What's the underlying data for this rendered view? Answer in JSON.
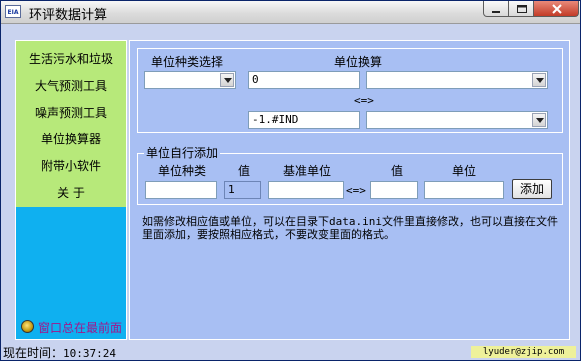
{
  "window": {
    "title": "环评数据计算",
    "icon_text": "EIA",
    "icon": "eia-app-icon"
  },
  "nav": {
    "items": [
      {
        "label": "生活污水和垃圾"
      },
      {
        "label": "大气预测工具"
      },
      {
        "label": "噪声预测工具"
      },
      {
        "label": "单位换算器"
      },
      {
        "label": "附带小软件"
      },
      {
        "label": "关  于"
      }
    ],
    "pin_label": "窗口总在最前面",
    "pin_icon": "pin-circle-icon"
  },
  "converter": {
    "unit_type_label": "单位种类选择",
    "conversion_label": "单位换算",
    "unit_type_value": "",
    "input_value": "0",
    "from_unit": "",
    "swap_label": "<=>",
    "result_value": "-1.#IND",
    "to_unit": ""
  },
  "custom_units": {
    "group_title": "单位自行添加",
    "col_type": "单位种类",
    "col_value": "值",
    "col_base_unit": "基准单位",
    "col_value2": "值",
    "col_unit": "单位",
    "type_value": "",
    "base_value": "1",
    "base_unit_value": "",
    "swap_label": "<=>",
    "value2": "",
    "unit_value": "",
    "add_button": "添加"
  },
  "help": {
    "text": "如需修改相应值或单位，可以在目录下data.ini文件里直接修改，也可以直接在文件里面添加，要按照相应格式，不要改变里面的格式。"
  },
  "status": {
    "time_label": "现在时间：",
    "time_value": "10:37:24",
    "email": "lyuder@zjip.com"
  },
  "colors": {
    "window_bg": "#c9d3ef",
    "left_panel": "#0fb0f0",
    "nav_bg": "#b7e97a",
    "right_panel": "#a8bff3",
    "pin_text": "#a0178c",
    "email_bg": "#eef19a"
  }
}
